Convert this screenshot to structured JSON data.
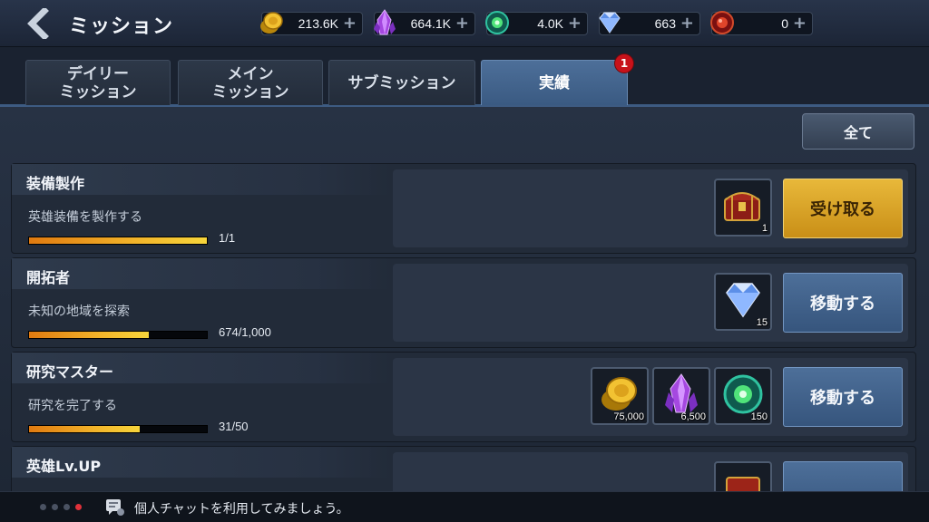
{
  "header": {
    "title": "ミッション",
    "back_icon": "back-arrow-icon"
  },
  "currencies": [
    {
      "name": "gold",
      "icon": "gold-coin-icon",
      "value": "213.6K"
    },
    {
      "name": "crystal",
      "icon": "purple-crystal-icon",
      "value": "664.1K"
    },
    {
      "name": "orb",
      "icon": "green-orb-icon",
      "value": "4.0K"
    },
    {
      "name": "diamond",
      "icon": "diamond-icon",
      "value": "663"
    },
    {
      "name": "ruby",
      "icon": "red-gem-icon",
      "value": "0"
    }
  ],
  "tabs": [
    {
      "label": "デイリー\nミッション",
      "active": false
    },
    {
      "label": "メイン\nミッション",
      "active": false
    },
    {
      "label": "サブミッション",
      "active": false
    },
    {
      "label": "実績",
      "active": true,
      "badge": "1"
    }
  ],
  "all_button": "全て",
  "missions": [
    {
      "title": "装備製作",
      "description": "英雄装備を製作する",
      "progress_text": "1/1",
      "progress": 1.0,
      "rewards": [
        {
          "icon": "treasure-chest-icon",
          "qty": "1"
        }
      ],
      "action": "受け取る",
      "action_type": "claim"
    },
    {
      "title": "開拓者",
      "description": "未知の地域を探索",
      "progress_text": "674/1,000",
      "progress": 0.674,
      "rewards": [
        {
          "icon": "diamond-icon",
          "qty": "15"
        }
      ],
      "action": "移動する",
      "action_type": "go"
    },
    {
      "title": "研究マスター",
      "description": "研究を完了する",
      "progress_text": "31/50",
      "progress": 0.62,
      "rewards": [
        {
          "icon": "gold-coin-icon",
          "qty": "75,000"
        },
        {
          "icon": "purple-crystal-icon",
          "qty": "6,500"
        },
        {
          "icon": "green-orb-icon",
          "qty": "150"
        }
      ],
      "action": "移動する",
      "action_type": "go"
    },
    {
      "title": "英雄Lv.UP"
    }
  ],
  "chat": {
    "text": "個人チャットを利用してみましょう。"
  },
  "colors": {
    "active_tab": "#4d6f99",
    "claim_button": "#e0ae2f",
    "go_button": "#4a6b95",
    "progress_fill": "#f2b42a",
    "badge": "#c8121a"
  }
}
